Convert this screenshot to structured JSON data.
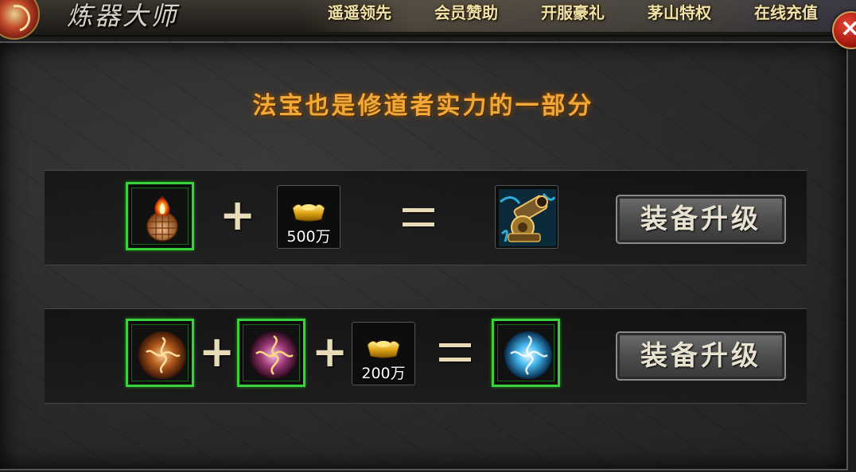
{
  "header": {
    "title": "炼器大师",
    "menu": [
      "遥遥领先",
      "会员赞助",
      "开服豪礼",
      "茅山特权",
      "在线充值"
    ]
  },
  "panel": {
    "headline": "法宝也是修道者实力的一部分"
  },
  "recipes": [
    {
      "cost_label": "500万",
      "button_label": "装备升级"
    },
    {
      "cost_label": "200万",
      "button_label": "装备升级"
    }
  ],
  "icons": {
    "close": "close-icon",
    "logo": "taiji-logo-icon",
    "gold_ingot": "gold-ingot-icon",
    "fire_seed": "fire-seed-item-icon",
    "cannon": "cannon-artifact-icon",
    "bronze_orb": "bronze-orb-item-icon",
    "purple_orb": "purple-orb-item-icon",
    "blue_orb": "blue-orb-item-icon"
  },
  "colors": {
    "headline": "#f0a838",
    "menu_text": "#f3e2a8",
    "slot_border": "#3ad23a",
    "button_bg": "#4d4d4d"
  }
}
